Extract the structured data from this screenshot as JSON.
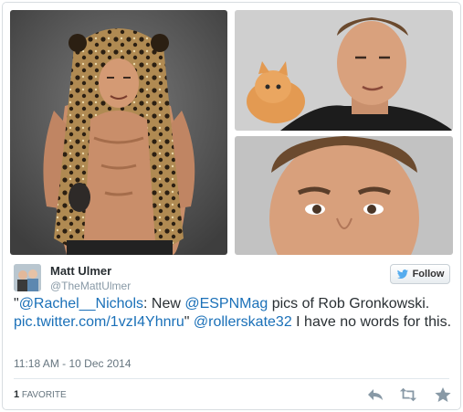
{
  "author": {
    "name": "Matt Ulmer",
    "handle": "@TheMattUlmer"
  },
  "follow_label": "Follow",
  "tweet": {
    "quote_open": "\"",
    "mention1": "@Rachel__Nichols",
    "text1": ": New ",
    "mention2": "@ESPNMag",
    "text2": " pics of Rob Gronkowski.",
    "link": "pic.twitter.com/1vzI4Yhnru",
    "quote_close": "\" ",
    "mention3": "@rollerskate32",
    "text3": " I have no words for this."
  },
  "timestamp": "11:18 AM - 10 Dec 2014",
  "stats": {
    "favorites_count": "1",
    "favorites_label": "FAVORITE"
  },
  "icons": {
    "reply": "reply-icon",
    "retweet": "retweet-icon",
    "favorite": "star-icon",
    "follow": "bird-icon"
  },
  "colors": {
    "link": "#1a70b8",
    "muted": "#8899a6",
    "text": "#292f33"
  }
}
